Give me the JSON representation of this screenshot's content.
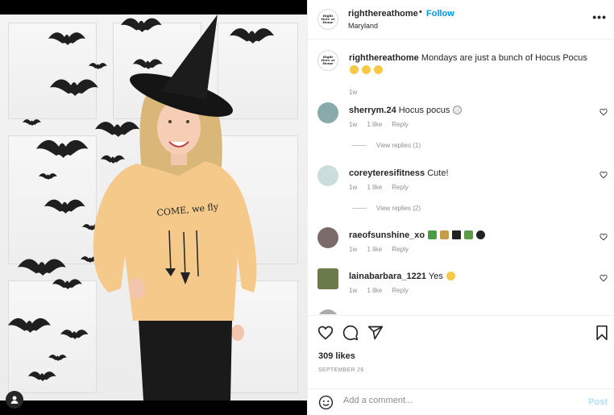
{
  "post": {
    "username": "righthereathome",
    "follow_label": "Follow",
    "bullet": "•",
    "location": "Maryland",
    "more_glyph": "•••",
    "avatar_text": "Right Here at Home",
    "caption": "Mondays are just a bunch of Hocus Pocus",
    "caption_time": "1w"
  },
  "comments": [
    {
      "user": "sherrym.24",
      "text": "Hocus pocus",
      "time": "1w",
      "likes": "1 like",
      "reply": "Reply",
      "view_replies": "View replies (1)"
    },
    {
      "user": "coreyteresifitness",
      "text": "Cute!",
      "time": "1w",
      "likes": "1 like",
      "reply": "Reply",
      "view_replies": "View replies (2)"
    },
    {
      "user": "raeofsunshine_xo",
      "text": "",
      "time": "1w",
      "likes": "1 like",
      "reply": "Reply"
    },
    {
      "user": "lainabarbara_1221",
      "text": "Yes",
      "time": "1w",
      "likes": "1 like",
      "reply": "Reply"
    }
  ],
  "footer": {
    "likes": "309 likes",
    "date": "SEPTEMBER 26",
    "comment_placeholder": "Add a comment...",
    "post_label": "Post"
  },
  "icons": {
    "like": "heart-icon",
    "comment": "comment-icon",
    "share": "share-icon",
    "save": "bookmark-icon",
    "emoji": "smile-icon",
    "tag": "user-tag-icon"
  },
  "colors": {
    "accent": "#0095f6",
    "muted": "#8e8e8e",
    "text": "#262626",
    "sweater": "#f5c98a"
  }
}
